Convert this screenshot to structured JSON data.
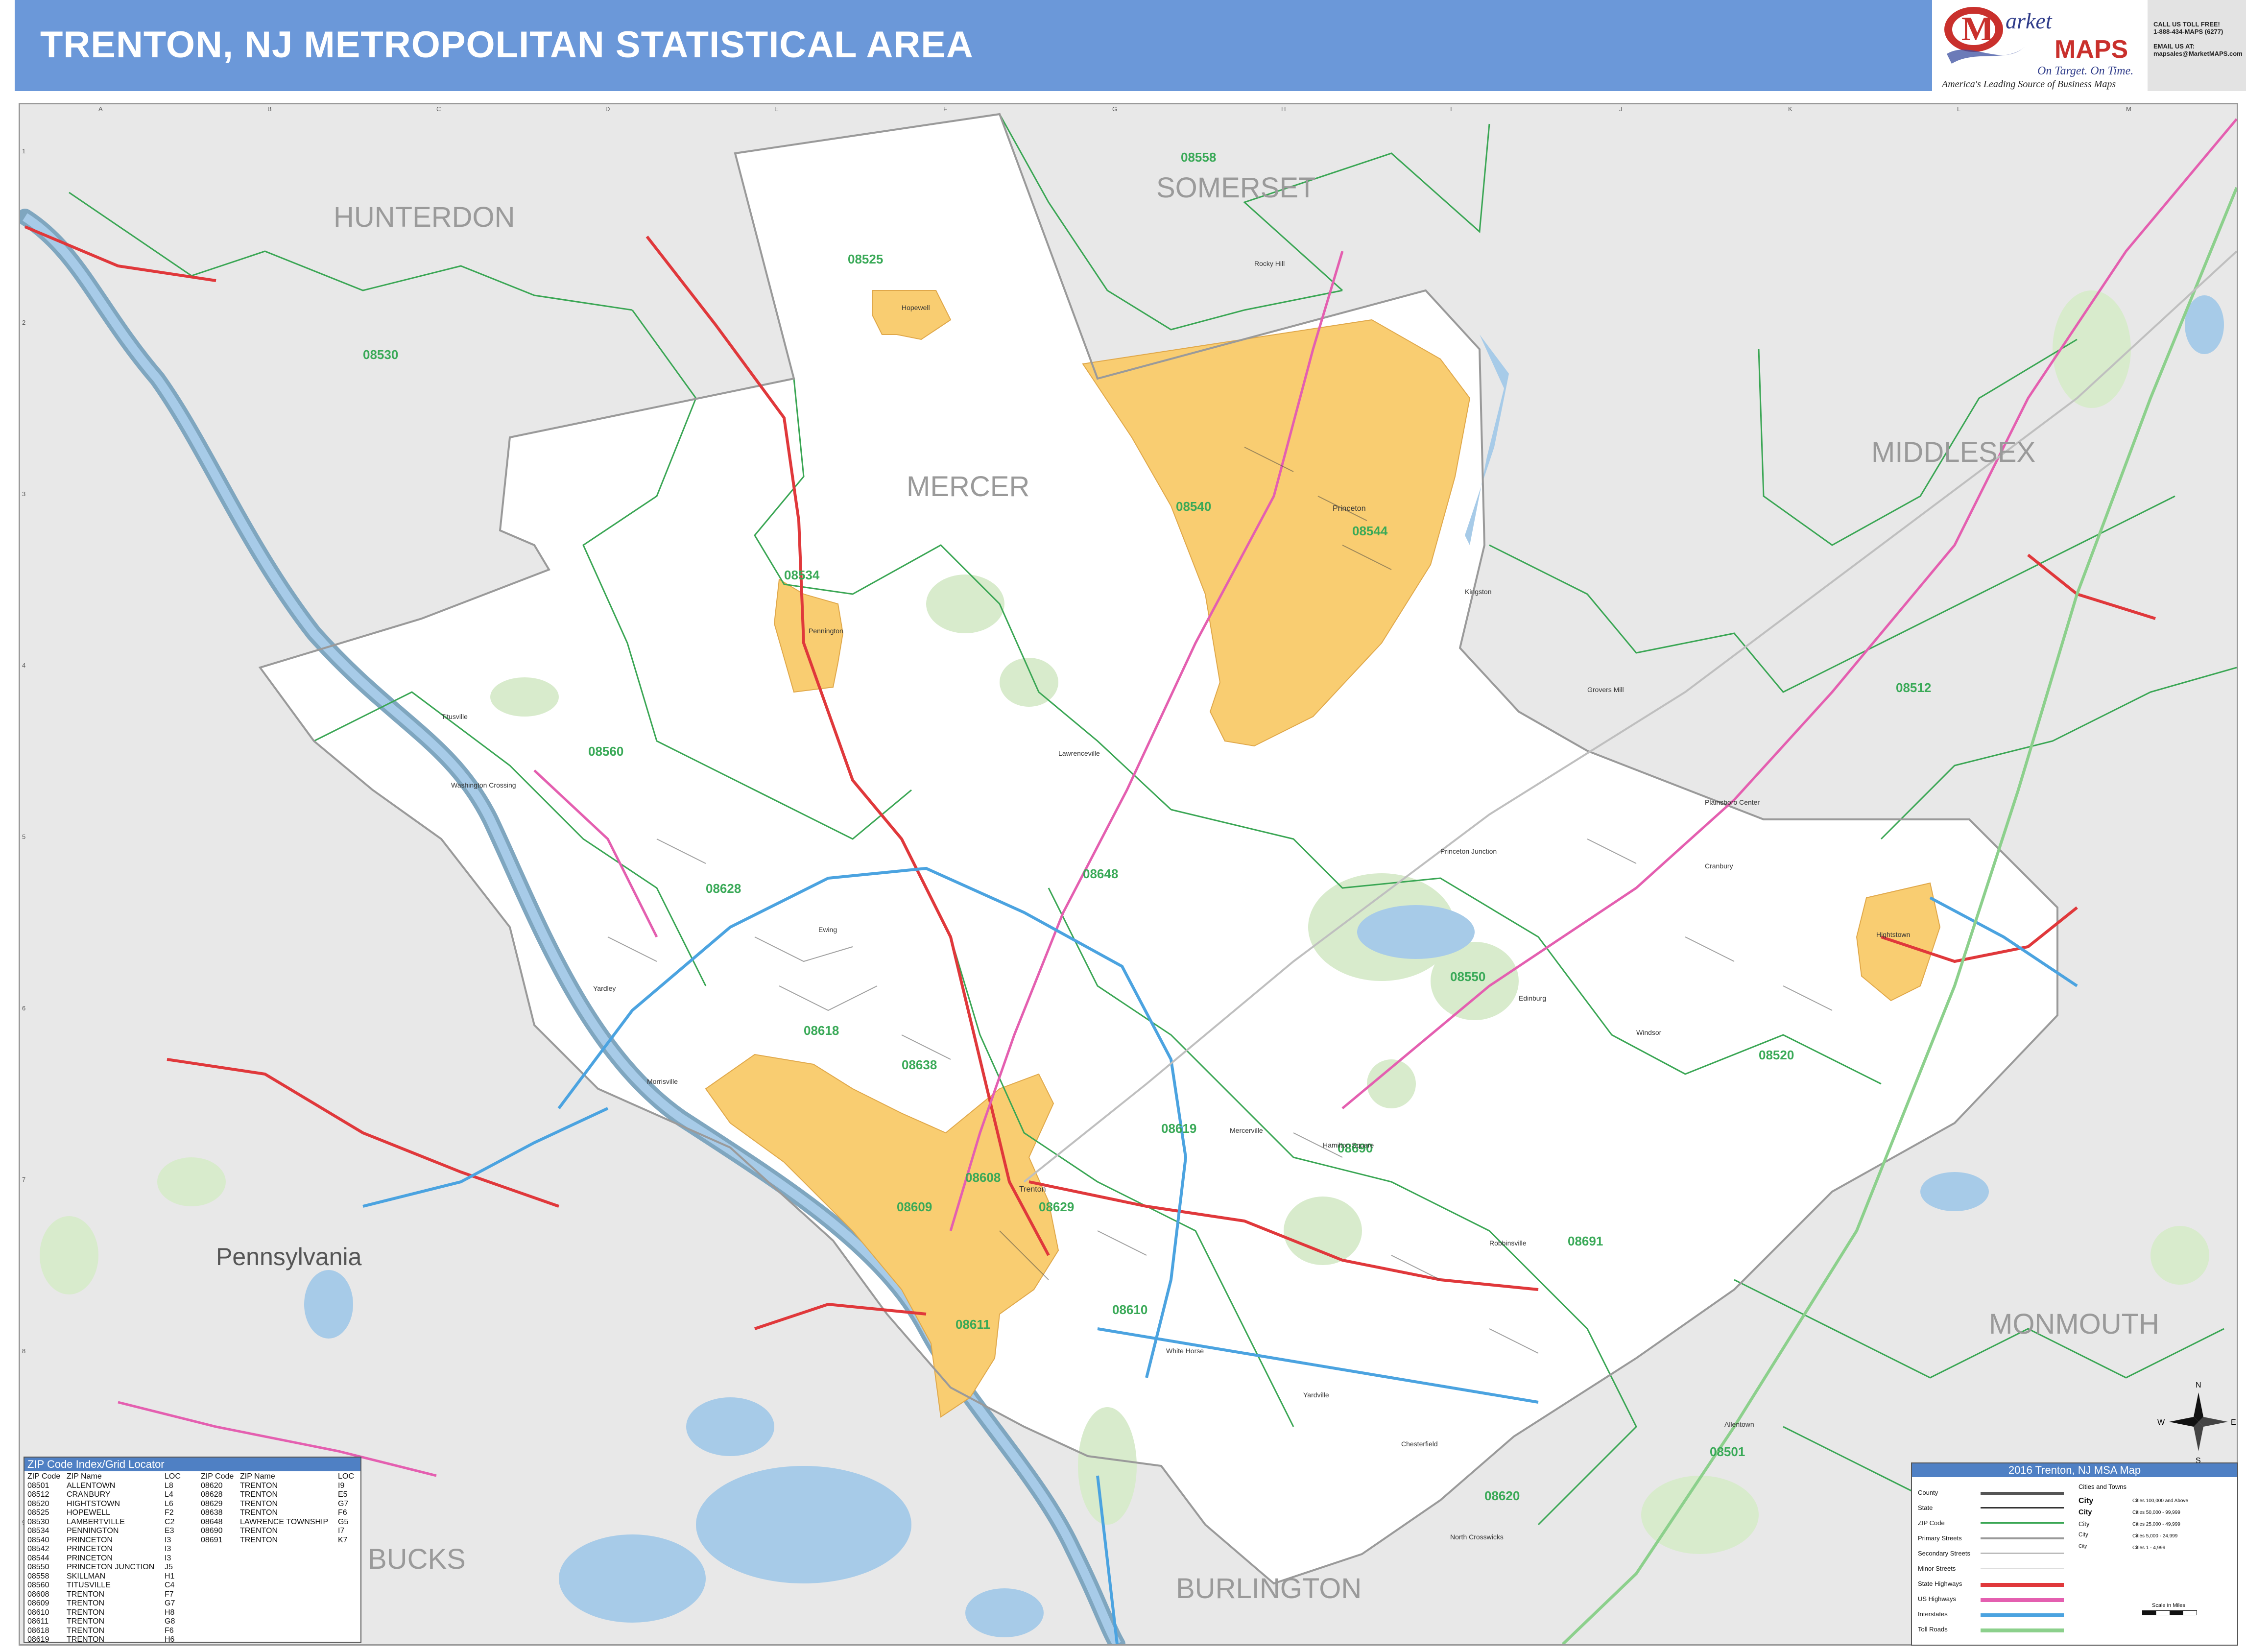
{
  "header": {
    "title": "TRENTON, NJ METROPOLITAN STATISTICAL AREA",
    "brand_market": "arket",
    "brand_maps": "MAPS",
    "brand_tagline1": "On Target. On Time.",
    "brand_tagline2": "America's Leading Source of Business Maps",
    "contact_lines": [
      "CALL US TOLL FREE!",
      "1-888-434-MAPS (6277)",
      "",
      "EMAIL US AT:",
      "mapsales@MarketMAPS.com"
    ]
  },
  "colors": {
    "title_bar": "#6b98d9",
    "map_background": "#e8e8e8",
    "county_fill": "#ffffff",
    "city_fill": "#f9cd71",
    "park_fill": "#d8ebcc",
    "water": "#a7cbe8",
    "zip_boundary": "#3aa654",
    "state_highway": "#e0383b",
    "us_highway": "#e45fb0",
    "interstate": "#4ba3e0",
    "toll_road": "#8cd08c"
  },
  "grid": {
    "columns": [
      "A",
      "B",
      "C",
      "D",
      "E",
      "F",
      "G",
      "H",
      "I",
      "J",
      "K",
      "L",
      "M"
    ],
    "rows": [
      "1",
      "2",
      "3",
      "4",
      "5",
      "6",
      "7",
      "8",
      "9"
    ]
  },
  "counties": [
    "HUNTERDON",
    "SOMERSET",
    "MERCER",
    "MIDDLESEX",
    "MONMOUTH",
    "BURLINGTON",
    "BUCKS",
    "Pennsylvania"
  ],
  "zip_labels": [
    "08558",
    "08525",
    "08530",
    "08540",
    "08544",
    "08534",
    "08560",
    "08628",
    "08648",
    "08512",
    "08550",
    "08618",
    "08638",
    "08520",
    "08690",
    "08619",
    "08608",
    "08629",
    "08609",
    "08691",
    "08611",
    "08610",
    "08620",
    "08501"
  ],
  "places": [
    "Hopewell",
    "Pennington",
    "Titusville",
    "Washington Crossing",
    "Lawrenceville",
    "Ewing",
    "Trenton",
    "Princeton",
    "Hightstown",
    "Plainsboro Center",
    "Princeton Junction",
    "Mercerville",
    "Hamilton Square",
    "Robbinsville",
    "Yardville",
    "White Horse",
    "Edinburg",
    "Windsor",
    "Cranbury",
    "Rocky Hill",
    "Kingston",
    "Yardley",
    "Morrisville",
    "Grovers Mill",
    "Allentown",
    "North Crosswicks",
    "Chesterfield"
  ],
  "zip_index": {
    "title": "ZIP Code Index/Grid Locator",
    "headers": [
      "ZIP Code",
      "ZIP Name",
      "LOC"
    ],
    "left": [
      [
        "08501",
        "ALLENTOWN",
        "L8"
      ],
      [
        "08512",
        "CRANBURY",
        "L4"
      ],
      [
        "08520",
        "HIGHTSTOWN",
        "L6"
      ],
      [
        "08525",
        "HOPEWELL",
        "F2"
      ],
      [
        "08530",
        "LAMBERTVILLE",
        "C2"
      ],
      [
        "08534",
        "PENNINGTON",
        "E3"
      ],
      [
        "08540",
        "PRINCETON",
        "I3"
      ],
      [
        "08542",
        "PRINCETON",
        "I3"
      ],
      [
        "08544",
        "PRINCETON",
        "I3"
      ],
      [
        "08550",
        "PRINCETON JUNCTION",
        "J5"
      ],
      [
        "08558",
        "SKILLMAN",
        "H1"
      ],
      [
        "08560",
        "TITUSVILLE",
        "C4"
      ],
      [
        "08608",
        "TRENTON",
        "F7"
      ],
      [
        "08609",
        "TRENTON",
        "G7"
      ],
      [
        "08610",
        "TRENTON",
        "H8"
      ],
      [
        "08611",
        "TRENTON",
        "G8"
      ],
      [
        "08618",
        "TRENTON",
        "F6"
      ],
      [
        "08619",
        "TRENTON",
        "H6"
      ]
    ],
    "right": [
      [
        "08620",
        "TRENTON",
        "I9"
      ],
      [
        "08628",
        "TRENTON",
        "E5"
      ],
      [
        "08629",
        "TRENTON",
        "G7"
      ],
      [
        "08638",
        "TRENTON",
        "F6"
      ],
      [
        "08648",
        "LAWRENCE TOWNSHIP",
        "G5"
      ],
      [
        "08690",
        "TRENTON",
        "I7"
      ],
      [
        "08691",
        "TRENTON",
        "K7"
      ]
    ]
  },
  "legend": {
    "title": "2016 Trenton, NJ MSA Map",
    "items": [
      "County",
      "State",
      "ZIP Code",
      "Primary Streets",
      "Secondary Streets",
      "Minor Streets",
      "State Highways",
      "US Highways",
      "Interstates",
      "Toll Roads"
    ],
    "cities_heading": "Cities and Towns",
    "city_levels": [
      {
        "label": "City",
        "size": "Cities 100,000 and Above"
      },
      {
        "label": "City",
        "size": "Cities 50,000 - 99,999"
      },
      {
        "label": "City",
        "size": "Cities 25,000 - 49,999"
      },
      {
        "label": "City",
        "size": "Cities 5,000 - 24,999"
      },
      {
        "label": "City",
        "size": "Cities 1 - 4,999"
      }
    ],
    "scale_label": "Scale in Miles"
  },
  "compass": [
    "N",
    "S",
    "E",
    "W"
  ]
}
